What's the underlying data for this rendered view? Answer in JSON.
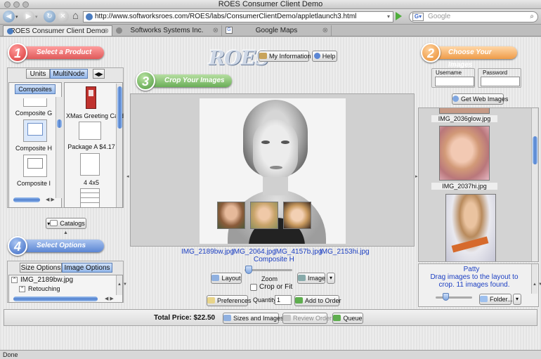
{
  "window": {
    "title": "ROES Consumer Client Demo"
  },
  "browser": {
    "url": "http://www.softworksroes.com/ROES/labs/ConsumerClientDemo/appletlaunch3.html",
    "search_placeholder": "Google",
    "tabs": [
      {
        "label": "ROES Consumer Client Demo"
      },
      {
        "label": "Softworks Systems Inc."
      },
      {
        "label": "Google Maps"
      }
    ]
  },
  "steps": {
    "select_product": {
      "number": "1",
      "label": "Select a Product"
    },
    "crop_images": {
      "number": "3",
      "label": "Crop Your Images"
    },
    "choose_images": {
      "number": "2",
      "label": "Choose Your Images"
    },
    "select_options": {
      "number": "4",
      "label": "Select Options"
    }
  },
  "header": {
    "logo_text": "ROES",
    "my_information": "My Information",
    "help": "Help"
  },
  "product_panel": {
    "tabs": [
      "Units",
      "MultiNode"
    ],
    "active_tab": "MultiNode",
    "category_tab": "Composites",
    "composites": [
      "Composite G",
      "Composite H",
      "Composite I"
    ],
    "products": [
      "XMas Greeting Card",
      "Package A $4.17",
      "4 4x5"
    ],
    "catalogs": "Catalogs"
  },
  "crop_area": {
    "filenames": [
      "IMG_2189bw.jpg",
      "IMG_2064.jpg",
      "IMG_4157b.jpg",
      "IMG_2153hi.jpg"
    ],
    "layout_name": "Composite H",
    "layout_btn": "Layout",
    "zoom_label": "Zoom",
    "image_btn": "Image",
    "crop_or_fit": "Crop or Fit",
    "preferences": "Preferences",
    "quantity_label": "Quantity",
    "quantity_value": "1",
    "add_to_order": "Add to Order"
  },
  "login": {
    "username_label": "Username",
    "password_label": "Password",
    "get_web_images": "Get Web Images"
  },
  "image_browser": {
    "images": [
      "IMG_2036glow.jpg",
      "IMG_2037hi.jpg"
    ],
    "info_name": "Patty",
    "info_text": "Drag images to the layout to crop. 11 images found.",
    "folder_btn": "Folder..."
  },
  "options_panel": {
    "tabs": [
      "Size Options",
      "Image Options"
    ],
    "active_tab": "Image Options",
    "items": [
      "IMG_2189bw.jpg",
      "Retouching"
    ]
  },
  "footer": {
    "total_price": "Total Price: $22.50",
    "sizes_and_images": "Sizes and Images",
    "review_order": "Review Order",
    "queue": "Queue"
  },
  "status": {
    "text": "Done"
  },
  "colors": {
    "link_blue": "#1c3fc2",
    "step_red": "#e05a5a",
    "step_green": "#6aae57",
    "step_orange": "#ef9b48",
    "step_blue": "#5b86d4"
  }
}
